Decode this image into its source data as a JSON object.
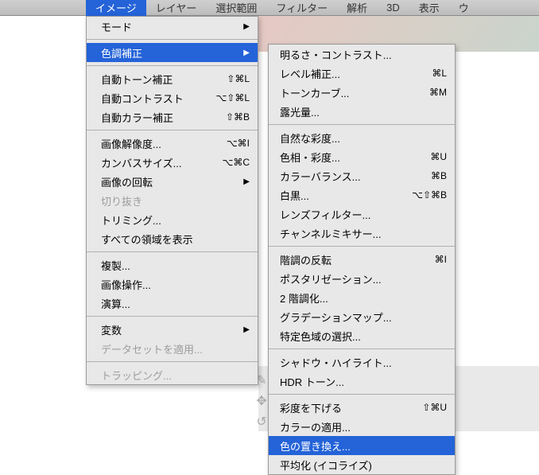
{
  "menubar": {
    "items": [
      {
        "label": "イメージ",
        "selected": true
      },
      {
        "label": "レイヤー"
      },
      {
        "label": "選択範囲"
      },
      {
        "label": "フィルター"
      },
      {
        "label": "解析"
      },
      {
        "label": "3D"
      },
      {
        "label": "表示"
      },
      {
        "label": "ウ"
      }
    ]
  },
  "main_menu": {
    "groups": [
      [
        {
          "label": "モード",
          "submenu": true
        }
      ],
      [
        {
          "label": "色調補正",
          "submenu": true,
          "highlight": true
        }
      ],
      [
        {
          "label": "自動トーン補正",
          "shortcut": "⇧⌘L"
        },
        {
          "label": "自動コントラスト",
          "shortcut": "⌥⇧⌘L"
        },
        {
          "label": "自動カラー補正",
          "shortcut": "⇧⌘B"
        }
      ],
      [
        {
          "label": "画像解像度...",
          "shortcut": "⌥⌘I"
        },
        {
          "label": "カンバスサイズ...",
          "shortcut": "⌥⌘C"
        },
        {
          "label": "画像の回転",
          "submenu": true
        },
        {
          "label": "切り抜き",
          "disabled": true
        },
        {
          "label": "トリミング..."
        },
        {
          "label": "すべての領域を表示"
        }
      ],
      [
        {
          "label": "複製..."
        },
        {
          "label": "画像操作..."
        },
        {
          "label": "演算..."
        }
      ],
      [
        {
          "label": "変数",
          "submenu": true
        },
        {
          "label": "データセットを適用...",
          "disabled": true
        }
      ],
      [
        {
          "label": "トラッピング...",
          "disabled": true
        }
      ]
    ]
  },
  "sub_menu": {
    "groups": [
      [
        {
          "label": "明るさ・コントラスト..."
        },
        {
          "label": "レベル補正...",
          "shortcut": "⌘L"
        },
        {
          "label": "トーンカーブ...",
          "shortcut": "⌘M"
        },
        {
          "label": "露光量..."
        }
      ],
      [
        {
          "label": "自然な彩度..."
        },
        {
          "label": "色相・彩度...",
          "shortcut": "⌘U"
        },
        {
          "label": "カラーバランス...",
          "shortcut": "⌘B"
        },
        {
          "label": "白黒...",
          "shortcut": "⌥⇧⌘B"
        },
        {
          "label": "レンズフィルター..."
        },
        {
          "label": "チャンネルミキサー..."
        }
      ],
      [
        {
          "label": "階調の反転",
          "shortcut": "⌘I"
        },
        {
          "label": "ポスタリゼーション..."
        },
        {
          "label": "2 階調化..."
        },
        {
          "label": "グラデーションマップ..."
        },
        {
          "label": "特定色域の選択..."
        }
      ],
      [
        {
          "label": "シャドウ・ハイライト..."
        },
        {
          "label": "HDR トーン..."
        }
      ],
      [
        {
          "label": "彩度を下げる",
          "shortcut": "⇧⌘U"
        },
        {
          "label": "カラーの適用..."
        },
        {
          "label": "色の置き換え...",
          "highlight": true
        },
        {
          "label": "平均化 (イコライズ)"
        }
      ]
    ]
  }
}
